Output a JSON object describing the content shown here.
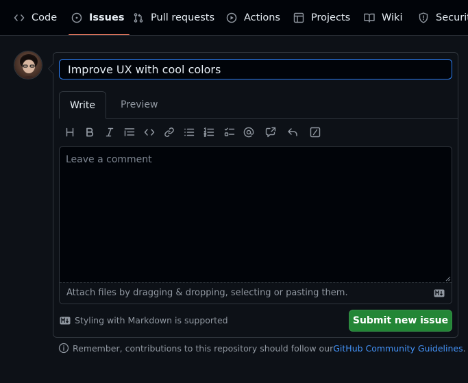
{
  "nav": {
    "tabs": [
      {
        "label": "Code",
        "icon": "code-icon"
      },
      {
        "label": "Issues",
        "icon": "issue-opened-icon",
        "active": true
      },
      {
        "label": "Pull requests",
        "icon": "git-pull-request-icon"
      },
      {
        "label": "Actions",
        "icon": "play-icon"
      },
      {
        "label": "Projects",
        "icon": "table-icon"
      },
      {
        "label": "Wiki",
        "icon": "book-icon"
      },
      {
        "label": "Security",
        "icon": "shield-icon"
      }
    ]
  },
  "issue_form": {
    "title_value": "Improve UX with cool colors",
    "tabs": {
      "write": "Write",
      "preview": "Preview"
    },
    "comment_placeholder": "Leave a comment",
    "attach_hint": "Attach files by dragging & dropping, selecting or pasting them.",
    "markdown_note": "Styling with Markdown is supported",
    "submit_label": "Submit new issue",
    "toolbar": [
      "heading-icon",
      "bold-icon",
      "italic-icon",
      "quote-icon",
      "code-icon",
      "link-icon",
      "bulleted-list-icon",
      "numbered-list-icon",
      "task-list-icon",
      "mention-icon",
      "cross-reference-icon",
      "reply-icon",
      "slash-command-icon"
    ]
  },
  "footer": {
    "reminder_text": "Remember, contributions to this repository should follow our ",
    "guidelines_link": "GitHub Community Guidelines",
    "reminder_end": "."
  },
  "colors": {
    "background": "#0d1117",
    "nav_background": "#010409",
    "active_tab_underline": "#f78166",
    "focus_border": "#2f81f7",
    "submit_green": "#238636",
    "link_blue": "#4493f8"
  }
}
